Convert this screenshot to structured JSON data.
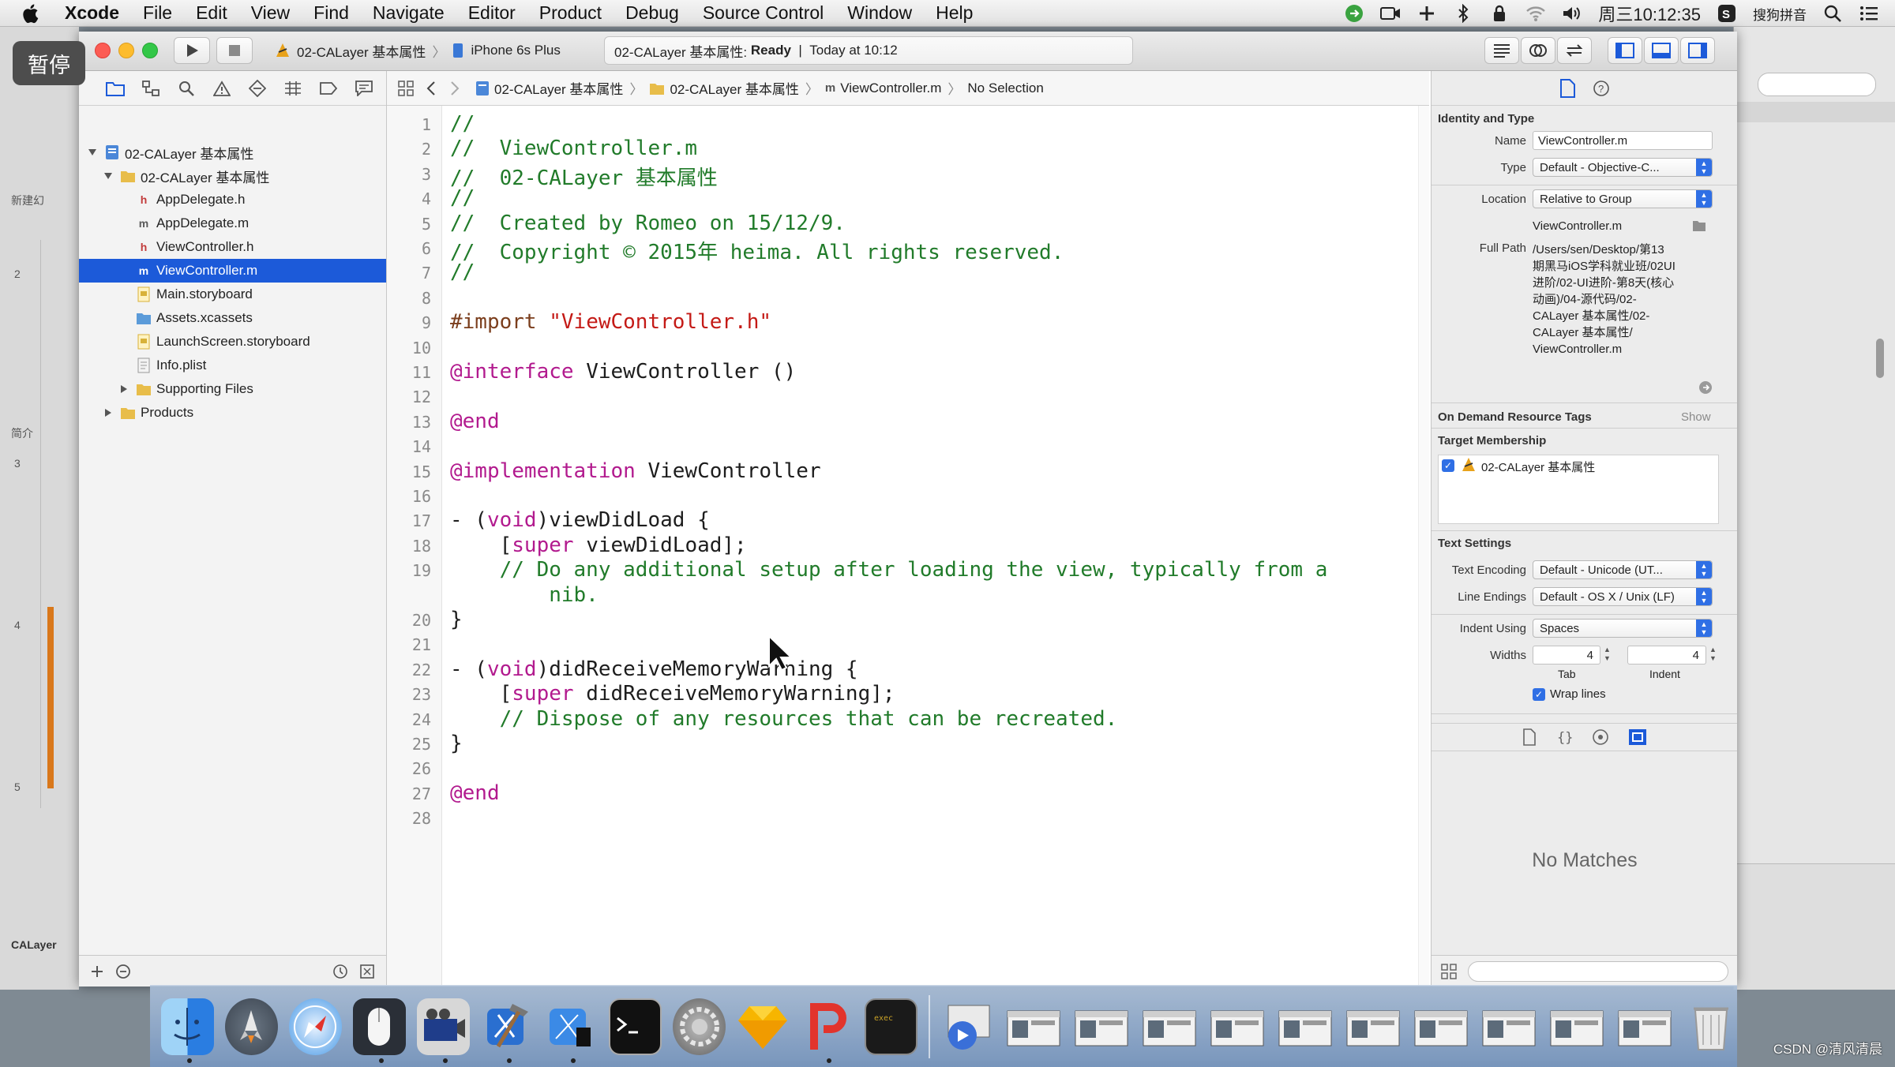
{
  "menubar": {
    "app": "Xcode",
    "items": [
      "File",
      "Edit",
      "View",
      "Find",
      "Navigate",
      "Editor",
      "Product",
      "Debug",
      "Source Control",
      "Window",
      "Help"
    ],
    "clock": "周三10:12:35",
    "ime": "搜狗拼音"
  },
  "overlay": {
    "pause": "暂停"
  },
  "background_window": {
    "labels": [
      "新建幻",
      "简介",
      "CALayer"
    ],
    "numbers": [
      "2",
      "3",
      "4",
      "5"
    ]
  },
  "toolbar": {
    "scheme": "02-CALayer 基本属性",
    "device": "iPhone 6s Plus",
    "status_project": "02-CALayer 基本属性: ",
    "status_state": "Ready",
    "status_sep": "  |  ",
    "status_time": "Today at 10:12"
  },
  "navigator": {
    "rows": [
      {
        "label": "02-CALayer 基本属性",
        "icon": "project-icon",
        "level": 0,
        "disclosure": "open"
      },
      {
        "label": "02-CALayer 基本属性",
        "icon": "folder-icon",
        "level": 1,
        "disclosure": "open"
      },
      {
        "label": "AppDelegate.h",
        "icon": "h-file-icon",
        "level": 2,
        "disclosure": ""
      },
      {
        "label": "AppDelegate.m",
        "icon": "m-file-icon",
        "level": 2,
        "disclosure": ""
      },
      {
        "label": "ViewController.h",
        "icon": "h-file-icon",
        "level": 2,
        "disclosure": ""
      },
      {
        "label": "ViewController.m",
        "icon": "m-file-icon",
        "level": 2,
        "disclosure": "",
        "selected": true
      },
      {
        "label": "Main.storyboard",
        "icon": "storyboard-icon",
        "level": 2,
        "disclosure": ""
      },
      {
        "label": "Assets.xcassets",
        "icon": "assets-folder-icon",
        "level": 2,
        "disclosure": ""
      },
      {
        "label": "LaunchScreen.storyboard",
        "icon": "storyboard-icon",
        "level": 2,
        "disclosure": ""
      },
      {
        "label": "Info.plist",
        "icon": "plist-icon",
        "level": 2,
        "disclosure": ""
      },
      {
        "label": "Supporting Files",
        "icon": "folder-icon",
        "level": 2,
        "disclosure": "closed"
      },
      {
        "label": "Products",
        "icon": "folder-icon",
        "level": 1,
        "disclosure": "closed"
      }
    ]
  },
  "jumpbar": {
    "crumbs": [
      "02-CALayer 基本属性",
      "02-CALayer 基本属性",
      "ViewController.m",
      "No Selection"
    ]
  },
  "editor": {
    "lines": [
      {
        "n": "1",
        "parts": [
          {
            "t": "//",
            "c": "comment"
          }
        ]
      },
      {
        "n": "2",
        "parts": [
          {
            "t": "//  ViewController.m",
            "c": "comment"
          }
        ]
      },
      {
        "n": "3",
        "parts": [
          {
            "t": "//  02-CALayer 基本属性",
            "c": "comment"
          }
        ]
      },
      {
        "n": "4",
        "parts": [
          {
            "t": "//",
            "c": "comment"
          }
        ]
      },
      {
        "n": "5",
        "parts": [
          {
            "t": "//  Created by Romeo on 15/12/9.",
            "c": "comment"
          }
        ]
      },
      {
        "n": "6",
        "parts": [
          {
            "t": "//  Copyright © 2015年 heima. All rights reserved.",
            "c": "comment"
          }
        ]
      },
      {
        "n": "7",
        "parts": [
          {
            "t": "//",
            "c": "comment"
          }
        ]
      },
      {
        "n": "8",
        "parts": []
      },
      {
        "n": "9",
        "parts": [
          {
            "t": "#import ",
            "c": "dir"
          },
          {
            "t": "\"ViewController.h\"",
            "c": "str"
          }
        ]
      },
      {
        "n": "10",
        "parts": []
      },
      {
        "n": "11",
        "parts": [
          {
            "t": "@interface",
            "c": "kw"
          },
          {
            "t": " ViewController ()",
            "c": ""
          }
        ]
      },
      {
        "n": "12",
        "parts": []
      },
      {
        "n": "13",
        "parts": [
          {
            "t": "@end",
            "c": "kw"
          }
        ]
      },
      {
        "n": "14",
        "parts": []
      },
      {
        "n": "15",
        "parts": [
          {
            "t": "@implementation",
            "c": "kw"
          },
          {
            "t": " ViewController",
            "c": ""
          }
        ]
      },
      {
        "n": "16",
        "parts": []
      },
      {
        "n": "17",
        "parts": [
          {
            "t": "- (",
            "c": ""
          },
          {
            "t": "void",
            "c": "kw"
          },
          {
            "t": ")viewDidLoad {",
            "c": ""
          }
        ]
      },
      {
        "n": "18",
        "parts": [
          {
            "t": "    [",
            "c": ""
          },
          {
            "t": "super",
            "c": "kw"
          },
          {
            "t": " viewDidLoad];",
            "c": ""
          }
        ]
      },
      {
        "n": "19",
        "parts": [
          {
            "t": "    // Do any additional setup after loading the view, typically from a",
            "c": "comment"
          }
        ]
      },
      {
        "n": "",
        "parts": [
          {
            "t": "        nib.",
            "c": "comment"
          }
        ]
      },
      {
        "n": "20",
        "parts": [
          {
            "t": "}",
            "c": ""
          }
        ]
      },
      {
        "n": "21",
        "parts": []
      },
      {
        "n": "22",
        "parts": [
          {
            "t": "- (",
            "c": ""
          },
          {
            "t": "void",
            "c": "kw"
          },
          {
            "t": ")didReceiveMemoryWarning {",
            "c": ""
          }
        ]
      },
      {
        "n": "23",
        "parts": [
          {
            "t": "    [",
            "c": ""
          },
          {
            "t": "super",
            "c": "kw"
          },
          {
            "t": " didReceiveMemoryWarning];",
            "c": ""
          }
        ]
      },
      {
        "n": "24",
        "parts": [
          {
            "t": "    // Dispose of any resources that can be recreated.",
            "c": "comment"
          }
        ]
      },
      {
        "n": "25",
        "parts": [
          {
            "t": "}",
            "c": ""
          }
        ]
      },
      {
        "n": "26",
        "parts": []
      },
      {
        "n": "27",
        "parts": [
          {
            "t": "@end",
            "c": "kw"
          }
        ]
      },
      {
        "n": "28",
        "parts": []
      }
    ]
  },
  "inspector": {
    "identity_title": "Identity and Type",
    "name_label": "Name",
    "name_value": "ViewController.m",
    "type_label": "Type",
    "type_value": "Default - Objective-C...",
    "location_label": "Location",
    "location_value": "Relative to Group",
    "location_file": "ViewController.m",
    "fullpath_label": "Full Path",
    "fullpath_lines": [
      "/Users/sen/Desktop/第13",
      "期黑马iOS学科就业班/02UI",
      "进阶/02-UI进阶-第8天(核心",
      "动画)/04-源代码/02-",
      "CALayer 基本属性/02-",
      "CALayer 基本属性/",
      "ViewController.m"
    ],
    "ondemand_title": "On Demand Resource Tags",
    "ondemand_show": "Show",
    "target_title": "Target Membership",
    "target_name": "02-CALayer 基本属性",
    "text_title": "Text Settings",
    "encoding_label": "Text Encoding",
    "encoding_value": "Default - Unicode (UT...",
    "endings_label": "Line Endings",
    "endings_value": "Default - OS X / Unix (LF)",
    "indent_label": "Indent Using",
    "indent_value": "Spaces",
    "widths_label": "Widths",
    "tab_value": "4",
    "indent_width_value": "4",
    "tab_label": "Tab",
    "indent_caption": "Indent",
    "wrap_label": "Wrap lines",
    "no_matches": "No Matches"
  },
  "dock": {
    "items": [
      "finder-icon",
      "launchpad-icon",
      "safari-icon",
      "mouse-app-icon",
      "photo-booth-icon",
      "xcode-icon",
      "xcode-blueprint-icon",
      "terminal-icon",
      "system-preferences-icon",
      "sketch-icon",
      "wps-icon",
      "console-icon"
    ],
    "minimized": 10
  },
  "watermark": "CSDN @清风清晨",
  "colors": {
    "selection": "#1c5ad9",
    "comment": "#217b2a",
    "keyword": "#b21a8e",
    "string": "#c41a16",
    "accent": "#2f6fe5"
  }
}
